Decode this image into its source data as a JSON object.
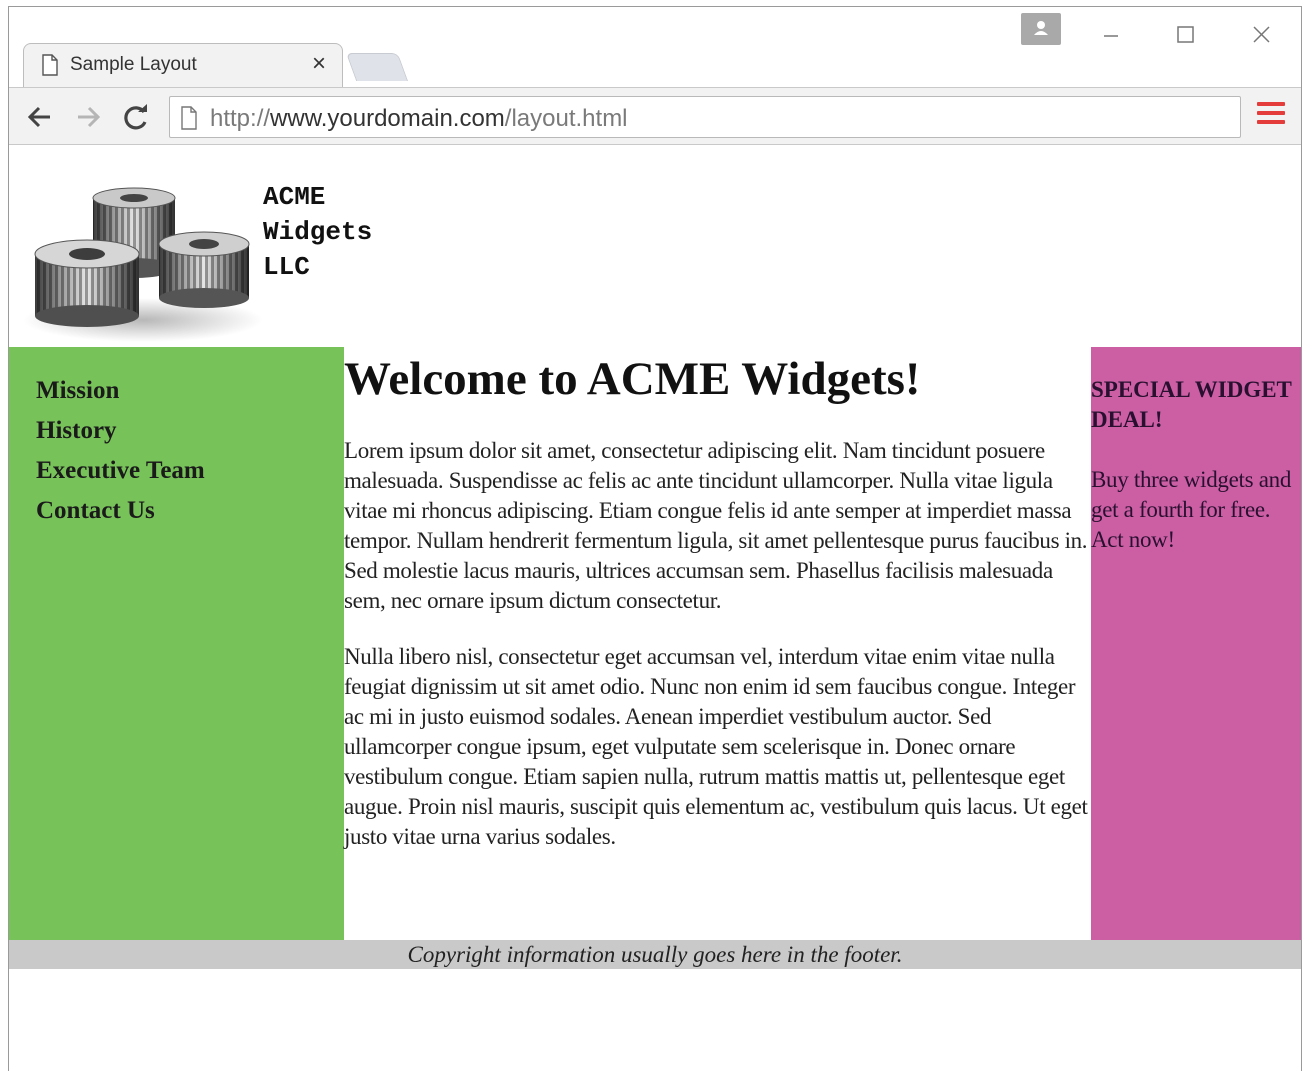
{
  "browser": {
    "tab_title": "Sample Layout",
    "tab_close": "×",
    "url_prefix": "http://",
    "url_domain": "www.yourdomain.com",
    "url_path": "/layout.html",
    "menu_color": "#e43b3b"
  },
  "site": {
    "logo_lines": [
      "ACME",
      "Widgets",
      "LLC"
    ],
    "nav": [
      "Mission",
      "History",
      "Executive Team",
      "Contact Us"
    ],
    "heading": "Welcome to ACME Widgets!",
    "paragraphs": [
      "Lorem ipsum dolor sit amet, consectetur adipiscing elit. Nam tincidunt posuere malesuada. Suspendisse ac felis ac ante tincidunt ullamcorper. Nulla vitae ligula vitae mi rhoncus adipiscing. Etiam congue felis id ante semper at imperdiet massa tempor. Nullam hendrerit fermentum ligula, sit amet pellentesque purus faucibus in. Sed molestie lacus mauris, ultrices accumsan sem. Phasellus facilisis malesuada sem, nec ornare ipsum dictum consectetur.",
      "Nulla libero nisl, consectetur eget accumsan vel, interdum vitae enim vitae nulla feugiat dignissim ut sit amet odio. Nunc non enim id sem faucibus congue. Integer ac mi in justo euismod sodales. Aenean imperdiet vestibulum auctor. Sed ullamcorper congue ipsum, eget vulputate sem scelerisque in. Donec ornare vestibulum congue. Etiam sapien nulla, rutrum mattis mattis ut, pellentesque eget augue. Proin nisl mauris, suscipit quis elementum ac, vestibulum quis lacus. Ut eget justo vitae urna varius sodales."
    ],
    "aside_title": "SPECIAL WIDGET DEAL!",
    "aside_text": "Buy three widgets and get a fourth for free. Act now!",
    "footer": "Copyright information usually goes here in the footer.",
    "colors": {
      "nav_bg": "#78c25a",
      "aside_bg": "#cc5fa4",
      "footer_bg": "#c9c9c9"
    }
  }
}
